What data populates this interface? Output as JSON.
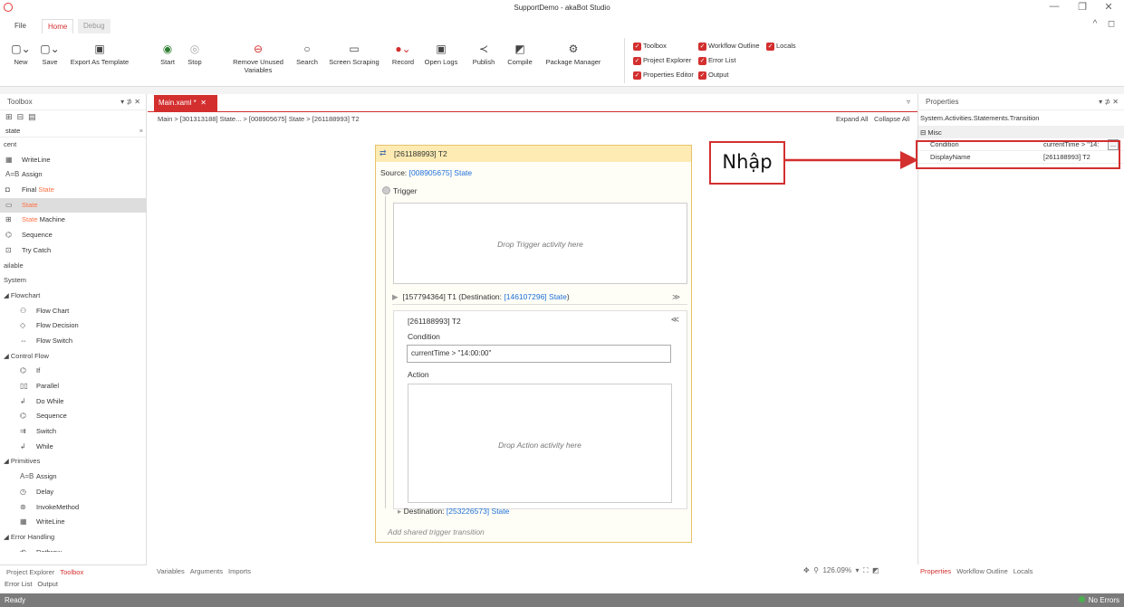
{
  "window": {
    "title": "SupportDemo - akaBot Studio",
    "minimize_glyph": "—",
    "restore_glyph": "❐",
    "close_glyph": "✕",
    "collapse_glyph": "^",
    "help_glyph": "◻"
  },
  "ribbon_tabs": [
    "File",
    "Home",
    "Debug"
  ],
  "ribbon_buttons": [
    {
      "icon": "new-icon",
      "glyph": "▢⌄",
      "label": "New"
    },
    {
      "icon": "save-icon",
      "glyph": "▢⌄",
      "label": "Save"
    },
    {
      "icon": "export-template-icon",
      "glyph": "▣",
      "label": "Export As Template"
    },
    {
      "icon": "start-icon",
      "glyph": "◉",
      "label": "Start"
    },
    {
      "icon": "stop-icon",
      "glyph": "◎",
      "label": "Stop"
    },
    {
      "icon": "remove-variables-icon",
      "glyph": "⊖",
      "label": "Remove Unused Variables"
    },
    {
      "icon": "search-icon",
      "glyph": "○",
      "label": "Search"
    },
    {
      "icon": "screen-scraping-icon",
      "glyph": "▭",
      "label": "Screen Scraping"
    },
    {
      "icon": "record-icon",
      "glyph": "●⌄",
      "label": "Record"
    },
    {
      "icon": "open-logs-icon",
      "glyph": "▣",
      "label": "Open Logs"
    },
    {
      "icon": "publish-icon",
      "glyph": "≺",
      "label": "Publish"
    },
    {
      "icon": "compile-icon",
      "glyph": "◩",
      "label": "Compile"
    },
    {
      "icon": "package-manager-icon",
      "glyph": "⚙",
      "label": "Package Manager"
    }
  ],
  "panel_checks": [
    {
      "label": "Toolbox",
      "checked": true
    },
    {
      "label": "Workflow Outline",
      "checked": true
    },
    {
      "label": "Locals",
      "checked": true
    },
    {
      "label": "Project Explorer",
      "checked": true
    },
    {
      "label": "Error List",
      "checked": true
    },
    {
      "label": "Properties Editor",
      "checked": true
    },
    {
      "label": "Output",
      "checked": true
    }
  ],
  "toolbox": {
    "title": "Toolbox",
    "controls": "▾ ⊅ ✕",
    "search_value": "state",
    "search_clear": "×",
    "items": [
      {
        "kind": "cat",
        "label": "cent"
      },
      {
        "kind": "item",
        "icon": "▦",
        "label": "WriteLine",
        "hl": ""
      },
      {
        "kind": "item",
        "icon": "A=B",
        "label": "Assign",
        "hl": ""
      },
      {
        "kind": "item",
        "icon": "◘",
        "pre": "Final ",
        "hl": "State",
        "label": ""
      },
      {
        "kind": "item",
        "icon": "▭",
        "pre": "",
        "hl": "State",
        "label": "",
        "sel": true
      },
      {
        "kind": "item",
        "icon": "⊞",
        "pre": "",
        "hl": "State",
        "label": " Machine"
      },
      {
        "kind": "item",
        "icon": "⌬",
        "label": "Sequence",
        "hl": ""
      },
      {
        "kind": "item",
        "icon": "⊡",
        "label": "Try Catch",
        "hl": ""
      },
      {
        "kind": "cat",
        "label": "ailable"
      },
      {
        "kind": "cat",
        "label": "System"
      },
      {
        "kind": "cat",
        "label": "◢ Flowchart"
      },
      {
        "kind": "sub",
        "icon": "⚇",
        "label": "Flow Chart"
      },
      {
        "kind": "sub",
        "icon": "◇",
        "label": "Flow Decision"
      },
      {
        "kind": "sub",
        "icon": "⇔",
        "label": "Flow Switch"
      },
      {
        "kind": "cat",
        "label": "◢ Control Flow"
      },
      {
        "kind": "sub",
        "icon": "⌬",
        "label": "If"
      },
      {
        "kind": "sub",
        "icon": "▯▯",
        "label": "Parallel"
      },
      {
        "kind": "sub",
        "icon": "↲",
        "label": "Do While"
      },
      {
        "kind": "sub",
        "icon": "⌬",
        "label": "Sequence"
      },
      {
        "kind": "sub",
        "icon": "⇉",
        "label": "Switch"
      },
      {
        "kind": "sub",
        "icon": "↲",
        "label": "While"
      },
      {
        "kind": "cat",
        "label": "◢ Primitives"
      },
      {
        "kind": "sub",
        "icon": "A=B",
        "label": "Assign"
      },
      {
        "kind": "sub",
        "icon": "◷",
        "label": "Delay"
      },
      {
        "kind": "sub",
        "icon": "⊛",
        "label": "InvokeMethod"
      },
      {
        "kind": "sub",
        "icon": "▦",
        "label": "WriteLine"
      },
      {
        "kind": "cat",
        "label": "◢ Error Handling"
      },
      {
        "kind": "sub",
        "icon": "⟲",
        "label": "Rethrow"
      }
    ]
  },
  "doc_tab": {
    "label": "Main.xaml *",
    "close": "✕"
  },
  "breadcrumb": "Main  >  [301313188] State...  >  [008905675] State  >  [261188993] T2",
  "expand_all": "Expand All",
  "collapse_all": "Collapse All",
  "designer": {
    "header": "[261188993] T2",
    "source_label": "Source: ",
    "source_link": "[008905675] State",
    "trigger_label": "Trigger",
    "drop_trigger": "Drop Trigger activity here",
    "t1_prefix": "[157794364] T1 (Destination: ",
    "t1_link": "[146107296] State",
    "t1_suffix": ")",
    "t2_title": "[261188993] T2",
    "condition_label": "Condition",
    "condition_value": "currentTime > \"14:00:00\"",
    "action_label": "Action",
    "drop_action": "Drop Action activity here",
    "destination_label": "Destination: ",
    "destination_link": "[253226573] State",
    "add_shared": "Add shared trigger transition"
  },
  "properties": {
    "title": "Properties",
    "controls": "▾ ⊅ ✕",
    "type": "System.Activities.Statements.Transition",
    "group": "⊟ Misc",
    "rows": [
      {
        "name": "Condition",
        "value": "currentTime > \"14:",
        "btn": "..."
      },
      {
        "name": "DisplayName",
        "value": "[261188993] T2"
      }
    ]
  },
  "annotation": {
    "text": "Nhập",
    "color": "#d32f2f"
  },
  "bottom_left_tabs": [
    "Project Explorer",
    "Toolbox"
  ],
  "bottom_left_tabs2": [
    "Error List",
    "Output"
  ],
  "bottom_center_tabs": [
    "Variables",
    "Arguments",
    "Imports"
  ],
  "zoom": "126.09%",
  "bottom_right_tabs": [
    "Properties",
    "Workflow Outline",
    "Locals"
  ],
  "status": {
    "left": "Ready",
    "right": "No Errors"
  },
  "accent_color": "#d32f2f"
}
